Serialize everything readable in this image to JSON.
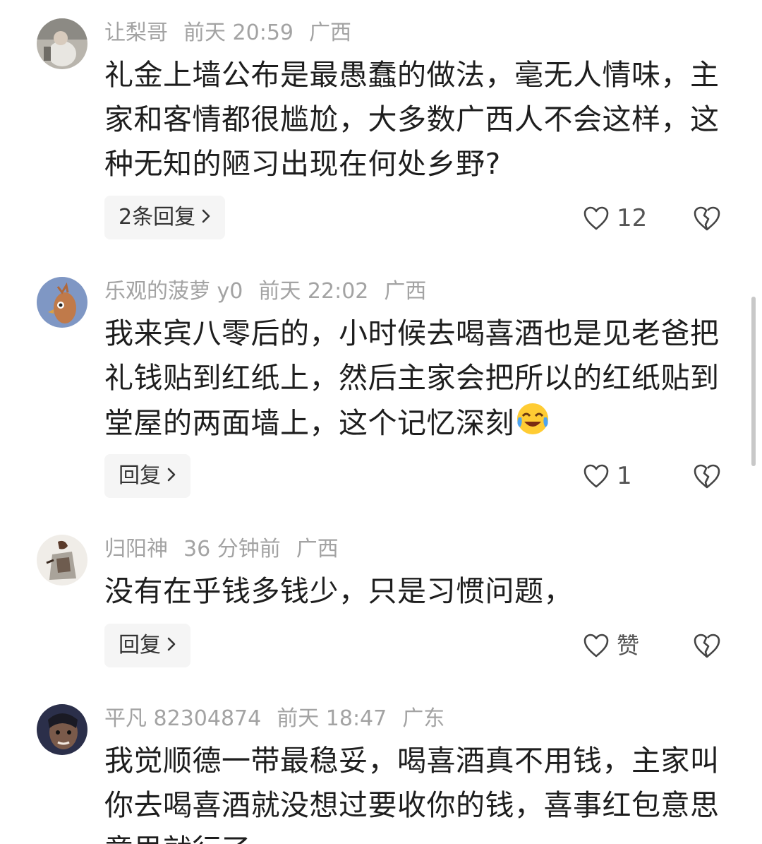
{
  "comments": [
    {
      "username": "让梨哥",
      "time": "前天 20:59",
      "location": "广西",
      "text": "礼金上墙公布是最愚蠢的做法，毫无人情味，主家和客情都很尴尬，大多数广西人不会这样，这种无知的陋习出现在何处乡野?",
      "reply_label": "2条回复",
      "like_count": "12"
    },
    {
      "username": "乐观的菠萝 y0",
      "time": "前天 22:02",
      "location": "广西",
      "text": "我来宾八零后的，小时候去喝喜酒也是见老爸把礼钱贴到红纸上，然后主家会把所以的红纸贴到堂屋的两面墙上，这个记忆深刻",
      "emoji": "laughing-crying-emoji",
      "reply_label": "回复",
      "like_count": "1"
    },
    {
      "username": "归阳神",
      "time": "36 分钟前",
      "location": "广西",
      "text": "没有在乎钱多钱少，只是习惯问题，",
      "reply_label": "回复",
      "like_count": "赞"
    },
    {
      "username": "平凡 82304874",
      "time": "前天 18:47",
      "location": "广东",
      "text": "我觉顺德一带最稳妥，喝喜酒真不用钱，主家叫你去喝喜酒就没想过要收你的钱，喜事红包意思意思就行了"
    }
  ],
  "icons": {
    "chevron": "chevron-right-icon",
    "like": "heart-outline-icon",
    "dislike": "broken-heart-icon"
  },
  "colors": {
    "meta_text": "#a3a3a3",
    "body_text": "#1e1e1e",
    "reply_bg": "#f5f5f5"
  }
}
